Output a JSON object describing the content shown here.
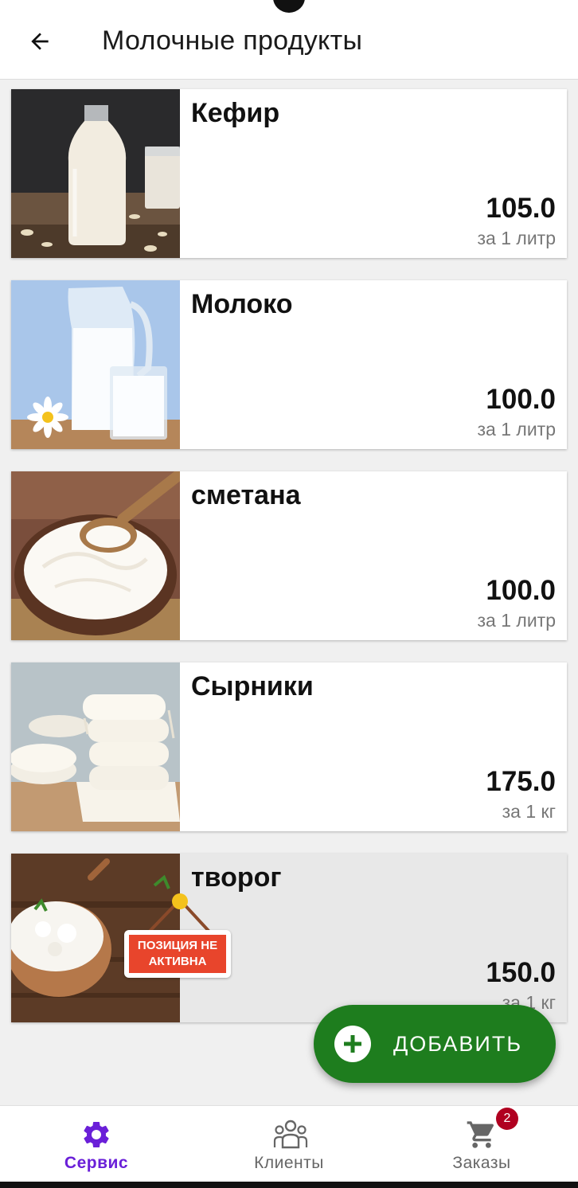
{
  "header": {
    "title": "Молочные продукты"
  },
  "products": [
    {
      "name": "Кефир",
      "price": "105.0",
      "unit": "за 1 литр",
      "image": "kefir-bottle-photo",
      "active": true
    },
    {
      "name": "Молоко",
      "price": "100.0",
      "unit": "за 1 литр",
      "image": "milk-jug-photo",
      "active": true
    },
    {
      "name": "сметана",
      "price": "100.0",
      "unit": "за 1 литр",
      "image": "sour-cream-bowl-photo",
      "active": true
    },
    {
      "name": "Сырники",
      "price": "175.0",
      "unit": "за 1 кг",
      "image": "cottage-cheese-pancakes-photo",
      "active": true
    },
    {
      "name": "творог",
      "price": "150.0",
      "unit": "за 1 кг",
      "image": "cottage-cheese-bowl-photo",
      "active": false,
      "badge": "ПОЗИЦИЯ НЕ АКТИВНА"
    }
  ],
  "fab": {
    "label": "ДОБАВИТЬ",
    "color": "#1e7d1e"
  },
  "bottom_nav": {
    "items": [
      {
        "label": "Сервис",
        "icon": "gear-icon",
        "active": true
      },
      {
        "label": "Клиенты",
        "icon": "people-icon",
        "active": false
      },
      {
        "label": "Заказы",
        "icon": "cart-icon",
        "active": false,
        "badge": "2"
      }
    ]
  },
  "colors": {
    "accent": "#6a1fd8",
    "fab": "#1e7d1e",
    "badge": "#b00020",
    "inactive_badge": "#e8452c"
  }
}
